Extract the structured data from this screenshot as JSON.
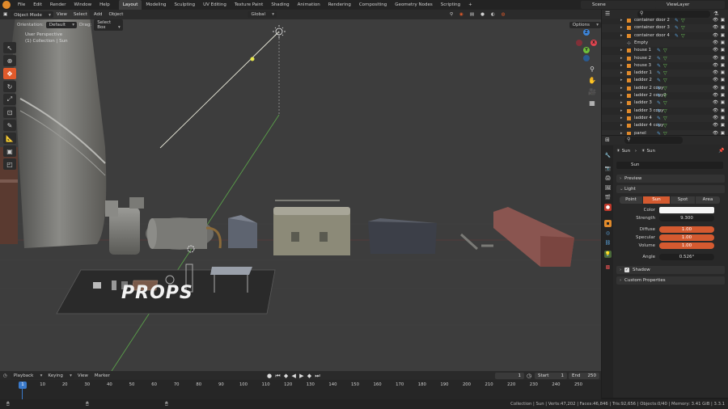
{
  "topbar": {
    "menus": [
      "File",
      "Edit",
      "Render",
      "Window",
      "Help"
    ],
    "workspaces": [
      "Layout",
      "Modeling",
      "Sculpting",
      "UV Editing",
      "Texture Paint",
      "Shading",
      "Animation",
      "Rendering",
      "Compositing",
      "Geometry Nodes",
      "Scripting"
    ],
    "active_workspace": "Layout",
    "add_workspace": "+",
    "scene": "Scene",
    "view_layer": "ViewLayer"
  },
  "viewport": {
    "mode": "Object Mode",
    "menus": [
      "View",
      "Select",
      "Add",
      "Object"
    ],
    "orientation_label": "Orientation:",
    "orientation_value": "Default",
    "drag_label": "Drag:",
    "drag_value": "Select Box",
    "transform_orientation": "Global",
    "options": "Options",
    "perspective": "User Perspective",
    "collection_info": "(1) Collection | Sun",
    "floor_text": "PROPS",
    "gizmo": {
      "x": "X",
      "y": "Y",
      "z": "Z"
    },
    "colors": {
      "active_tool": "#e05a2b",
      "x_axis": "#e0444f",
      "y_axis": "#6fbf3a",
      "z_axis": "#3d86db"
    }
  },
  "outliner": {
    "search_placeholder": "",
    "items": [
      {
        "name": "container door 2"
      },
      {
        "name": "container door 3"
      },
      {
        "name": "container door 4"
      },
      {
        "name": "Empty"
      },
      {
        "name": "house 1"
      },
      {
        "name": "house 2"
      },
      {
        "name": "house 3"
      },
      {
        "name": "ladder 1"
      },
      {
        "name": "ladder 2"
      },
      {
        "name": "ladder 2 copy"
      },
      {
        "name": "ladder 2 copy2"
      },
      {
        "name": "ladder 3"
      },
      {
        "name": "ladder 3 copy"
      },
      {
        "name": "ladder 4"
      },
      {
        "name": "ladder 4 copy"
      },
      {
        "name": "panel"
      }
    ]
  },
  "properties": {
    "breadcrumb_object": "Sun",
    "breadcrumb_data": "Sun",
    "datablock_name": "Sun",
    "panels": {
      "preview": "Preview",
      "light": "Light",
      "shadow": "Shadow",
      "custom_props": "Custom Properties"
    },
    "light_types": [
      "Point",
      "Sun",
      "Spot",
      "Area"
    ],
    "active_light_type": "Sun",
    "fields": {
      "color_label": "Color",
      "strength_label": "Strength",
      "strength_value": "9.300",
      "diffuse_label": "Diffuse",
      "diffuse_value": "1.00",
      "specular_label": "Specular",
      "specular_value": "1.00",
      "volume_label": "Volume",
      "volume_value": "1.00",
      "angle_label": "Angle",
      "angle_value": "0.526°"
    }
  },
  "timeline": {
    "menus": [
      "Playback",
      "Keying",
      "View",
      "Marker"
    ],
    "current_frame": "1",
    "start_label": "Start",
    "start_value": "1",
    "end_label": "End",
    "end_value": "250",
    "ruler": [
      "1",
      "10",
      "20",
      "30",
      "40",
      "50",
      "60",
      "70",
      "80",
      "90",
      "100",
      "110",
      "120",
      "130",
      "140",
      "150",
      "160",
      "170",
      "180",
      "190",
      "200",
      "210",
      "220",
      "230",
      "240",
      "250"
    ]
  },
  "statusbar": {
    "text": "Collection | Sun | Verts:47,202 | Faces:46,846 | Tris:92,656 | Objects:0/40 | Memory: 3.41 GiB | 3.3.1"
  }
}
